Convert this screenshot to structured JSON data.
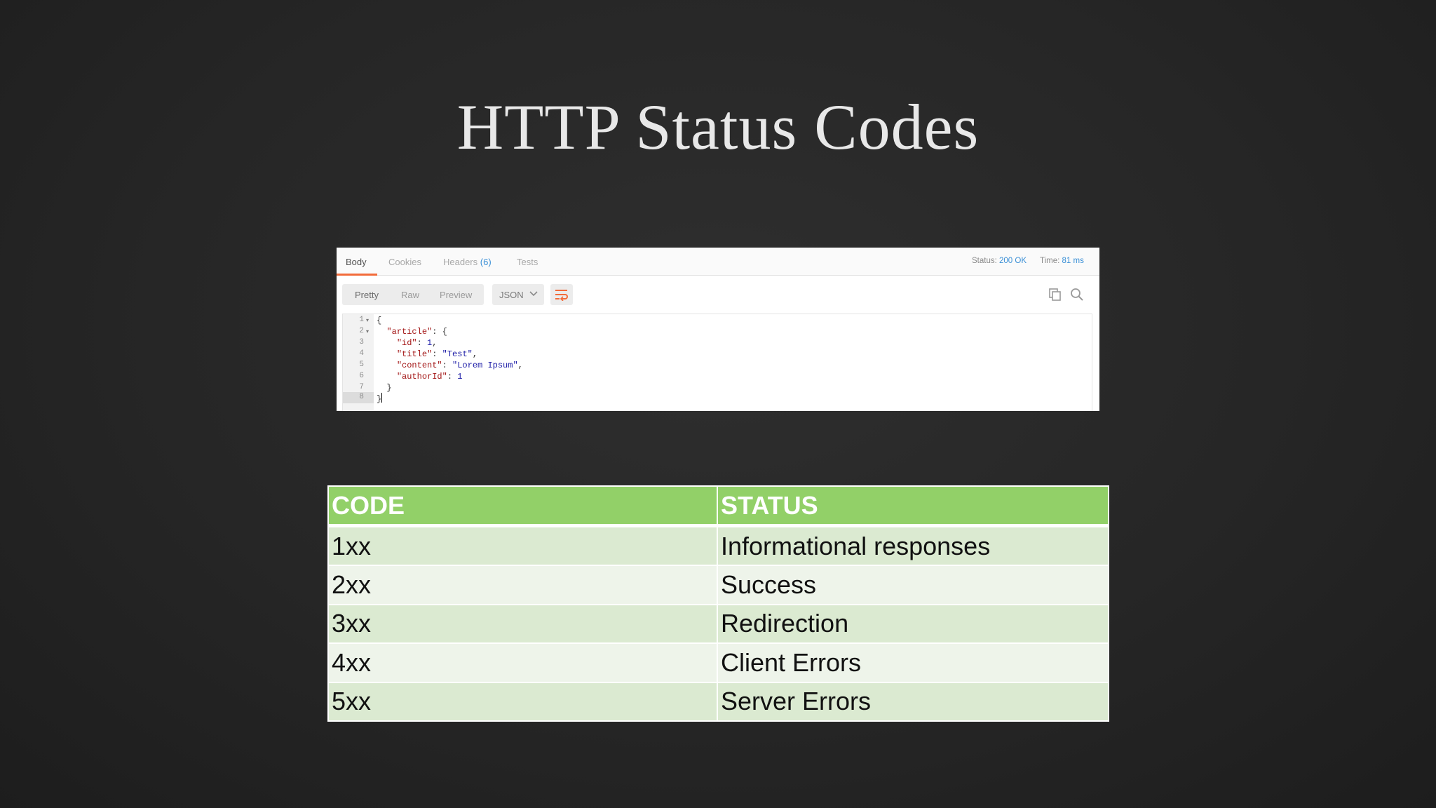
{
  "slide": {
    "title": "HTTP Status Codes"
  },
  "response_panel": {
    "tabs": [
      {
        "label": "Body"
      },
      {
        "label": "Cookies"
      },
      {
        "label": "Headers",
        "count": "(6)"
      },
      {
        "label": "Tests"
      }
    ],
    "status_label": "Status:",
    "status_value": "200 OK",
    "time_label": "Time:",
    "time_value": "81 ms",
    "view_modes": [
      "Pretty",
      "Raw",
      "Preview"
    ],
    "format": "JSON",
    "line_numbers": [
      "1",
      "2",
      "3",
      "4",
      "5",
      "6",
      "7",
      "8"
    ],
    "code": {
      "l1": "{",
      "l2_key": "\"article\"",
      "l2_rest": ": {",
      "l3_key": "\"id\"",
      "l3_val": "1",
      "l4_key": "\"title\"",
      "l4_val": "\"Test\"",
      "l5_key": "\"content\"",
      "l5_val": "\"Lorem Ipsum\"",
      "l6_key": "\"authorId\"",
      "l6_val": "1",
      "l7": "}",
      "l8": "}"
    },
    "icons": [
      "copy-icon",
      "search-icon",
      "wrap-lines-icon"
    ]
  },
  "status_table": {
    "headers": {
      "code": "CODE",
      "status": "STATUS"
    },
    "rows": [
      {
        "code": "1xx",
        "status": "Informational responses"
      },
      {
        "code": "2xx",
        "status": "Success"
      },
      {
        "code": "3xx",
        "status": "Redirection"
      },
      {
        "code": "4xx",
        "status": "Client Errors"
      },
      {
        "code": "5xx",
        "status": "Server Errors"
      }
    ],
    "colors": {
      "header": "#92d068",
      "row_dark": "#dbead1",
      "row_light": "#eef4ea"
    }
  }
}
